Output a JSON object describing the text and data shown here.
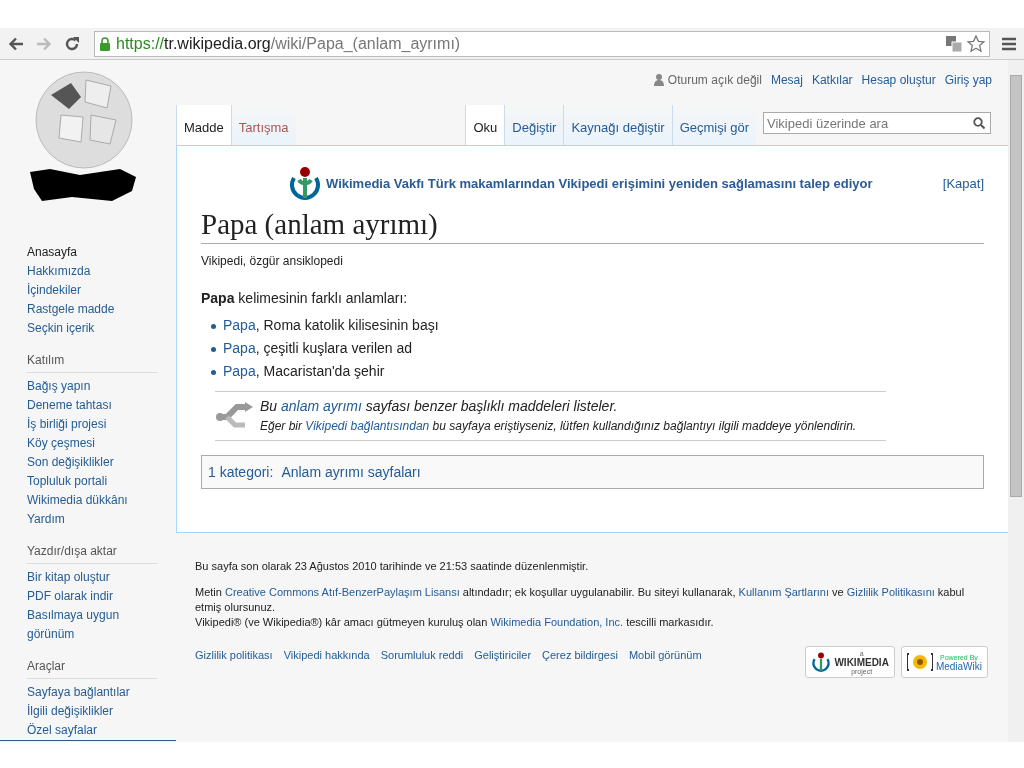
{
  "browser": {
    "url": {
      "scheme": "https://",
      "host": "tr.wikipedia.org",
      "path": "/wiki/Papa_(anlam_ayrımı)"
    }
  },
  "sidebar": {
    "nav": [
      "Anasayfa",
      "Hakkımızda",
      "İçindekiler",
      "Rastgele madde",
      "Seçkin içerik"
    ],
    "sections": [
      {
        "heading": "Katılım",
        "items": [
          "Bağış yapın",
          "Deneme tahtası",
          "İş birliği projesi",
          "Köy çeşmesi",
          "Son değişiklikler",
          "Topluluk portali",
          "Wikimedia dükkânı",
          "Yardım"
        ]
      },
      {
        "heading": "Yazdır/dışa aktar",
        "items": [
          "Bir kitap oluştur",
          "PDF olarak indir",
          "Basılmaya uygun görünüm"
        ]
      },
      {
        "heading": "Araçlar",
        "items": [
          "Sayfaya bağlantılar",
          "İlgili değişiklikler",
          "Özel sayfalar"
        ]
      }
    ]
  },
  "personal_links": [
    {
      "label": "Oturum açık değil",
      "kind": "status"
    },
    {
      "label": "Mesaj",
      "kind": "link"
    },
    {
      "label": "Katkılar",
      "kind": "link"
    },
    {
      "label": "Hesap oluştur",
      "kind": "link"
    },
    {
      "label": "Giriş yap",
      "kind": "link"
    }
  ],
  "tabs_left": [
    {
      "label": "Madde",
      "selected": true,
      "missing": false
    },
    {
      "label": "Tartışma",
      "selected": false,
      "missing": true
    }
  ],
  "tabs_right": [
    {
      "label": "Oku",
      "selected": true
    },
    {
      "label": "Değiştir",
      "selected": false
    },
    {
      "label": "Kaynağı değiştir",
      "selected": false
    },
    {
      "label": "Geçmişi gör",
      "selected": false
    }
  ],
  "search": {
    "placeholder": "Vikipedi üzerinde ara"
  },
  "banner": {
    "text": "Wikimedia Vakfı Türk makamlarından Vikipedi erişimini yeniden sağlamasını talep ediyor",
    "close": "[Kapat]"
  },
  "title": "Papa (anlam ayrımı)",
  "tagline": "Vikipedi, özgür ansiklopedi",
  "intro": "**Papa** kelimesinin farklı anlamları:",
  "meanings": [
    {
      "link": "Papa",
      "text": ", Roma katolik kilisesinin başı"
    },
    {
      "link": "Papa",
      "text": ", çeşitli kuşlara verilen ad"
    },
    {
      "link": "Papa",
      "text": ", Macaristan'da şehir"
    }
  ],
  "notice": {
    "line_1": {
      "before": "Bu ",
      "link": "anlam ayrımı",
      "after": " sayfası benzer başlıklı maddeleri listeler."
    },
    "line_2": {
      "before": "Eğer bir ",
      "link": "Vikipedi bağlantısından",
      "after": " bu sayfaya eriştiyseniz, lütfen kullandığınız bağlantıyı ilgili maddeye yönlendirin."
    }
  },
  "categories": {
    "label": "1 kategori:",
    "items": [
      "Anlam ayrımı sayfaları"
    ]
  },
  "footer": {
    "last_modified": "Bu sayfa son olarak 23 Ağustos 2010 tarihinde ve 21:53 saatinde düzenlenmiştir.",
    "license": [
      {
        "text": "Metin ",
        "link": false
      },
      {
        "text": "Creative Commons Atıf-BenzerPaylaşım Lisansı",
        "link": true
      },
      {
        "text": " altındadır; ek koşullar uygulanabilir. Bu siteyi kullanarak, ",
        "link": false
      },
      {
        "text": "Kullanım Şartlarını",
        "link": true
      },
      {
        "text": " ve ",
        "link": false
      },
      {
        "text": "Gizlilik Politikasını",
        "link": true
      },
      {
        "text": " kabul etmiş olursunuz.",
        "link": false
      }
    ],
    "trademark": [
      {
        "text": "Vikipedi® (ve Wikipedia®) kâr amacı gütmeyen kuruluş olan ",
        "link": false
      },
      {
        "text": "Wikimedia Foundation, Inc.",
        "link": true
      },
      {
        "text": " tescilli markasıdır.",
        "link": false
      }
    ],
    "links": [
      "Gizlilik politikası",
      "Vikipedi hakkında",
      "Sorumluluk reddi",
      "Geliştiriciler",
      "Çerez bildirgesi",
      "Mobil görünüm"
    ],
    "badges": [
      {
        "kind": "wikimedia",
        "lines": [
          "a",
          "WIKIMEDIA",
          "project"
        ]
      },
      {
        "kind": "mediawiki",
        "lines": [
          "Powered By",
          "MediaWiki"
        ]
      }
    ]
  }
}
